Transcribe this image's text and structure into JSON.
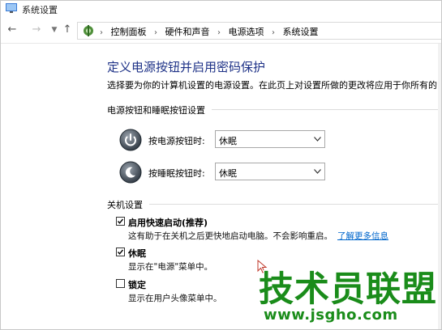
{
  "window": {
    "title": "系统设置"
  },
  "nav": {
    "breadcrumbs": [
      "控制面板",
      "硬件和声音",
      "电源选项",
      "系统设置"
    ]
  },
  "main": {
    "title": "定义电源按钮并启用密码保护",
    "description": "选择要为你的计算机设置的电源设置。在此页上对设置所做的更改将应用于你所有的电"
  },
  "power_section": {
    "header": "电源按钮和睡眠按钮设置",
    "rows": [
      {
        "label": "按电源按钮时:",
        "value": "休眠"
      },
      {
        "label": "按睡眠按钮时:",
        "value": "休眠"
      }
    ]
  },
  "shutdown_section": {
    "header": "关机设置",
    "options": [
      {
        "label": "启用快速启动(推荐)",
        "desc": "这有助于在关机之后更快地启动电脑。不会影响重启。",
        "link": "了解更多信息",
        "checked": true
      },
      {
        "label": "休眠",
        "desc": "显示在\"电源\"菜单中。",
        "checked": true
      },
      {
        "label": "锁定",
        "desc": "显示在用户头像菜单中。",
        "checked": false
      }
    ]
  },
  "watermark": {
    "text": "技术员联盟",
    "url": "www.jsgho.com"
  },
  "colors": {
    "title_blue": "#1e3287",
    "link_blue": "#0066cc",
    "watermark_green": "#1a8c1a"
  }
}
